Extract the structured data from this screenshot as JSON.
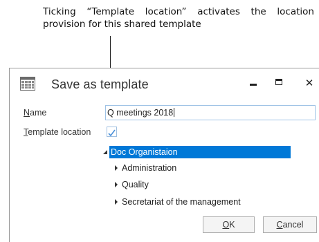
{
  "annotation": {
    "text": "Ticking “Template location” activates the location provision for this shared template"
  },
  "dialog": {
    "title": "Save as template",
    "window_controls": {
      "minimize_icon": "minimize-icon",
      "maximize_icon": "maximize-icon",
      "close_glyph": "✕"
    },
    "name_field": {
      "label_access_key": "N",
      "label_rest": "ame",
      "value": "Q meetings 2018"
    },
    "template_location": {
      "label_access_key": "T",
      "label_rest": "emplate location",
      "checked": true
    },
    "tree": {
      "root": {
        "label": "Doc Organistaion",
        "expanded": true,
        "selected": true
      },
      "children": [
        {
          "label": "Administration",
          "expanded": false
        },
        {
          "label": "Quality",
          "expanded": false
        },
        {
          "label": "Secretariat of the management",
          "expanded": false
        }
      ]
    },
    "buttons": {
      "ok_access_key": "O",
      "ok_rest": "K",
      "cancel_access_key": "C",
      "cancel_rest": "ancel"
    },
    "colors": {
      "selection": "#0078d7",
      "input_border": "#9fc3e6",
      "check": "#4a90d9"
    }
  }
}
